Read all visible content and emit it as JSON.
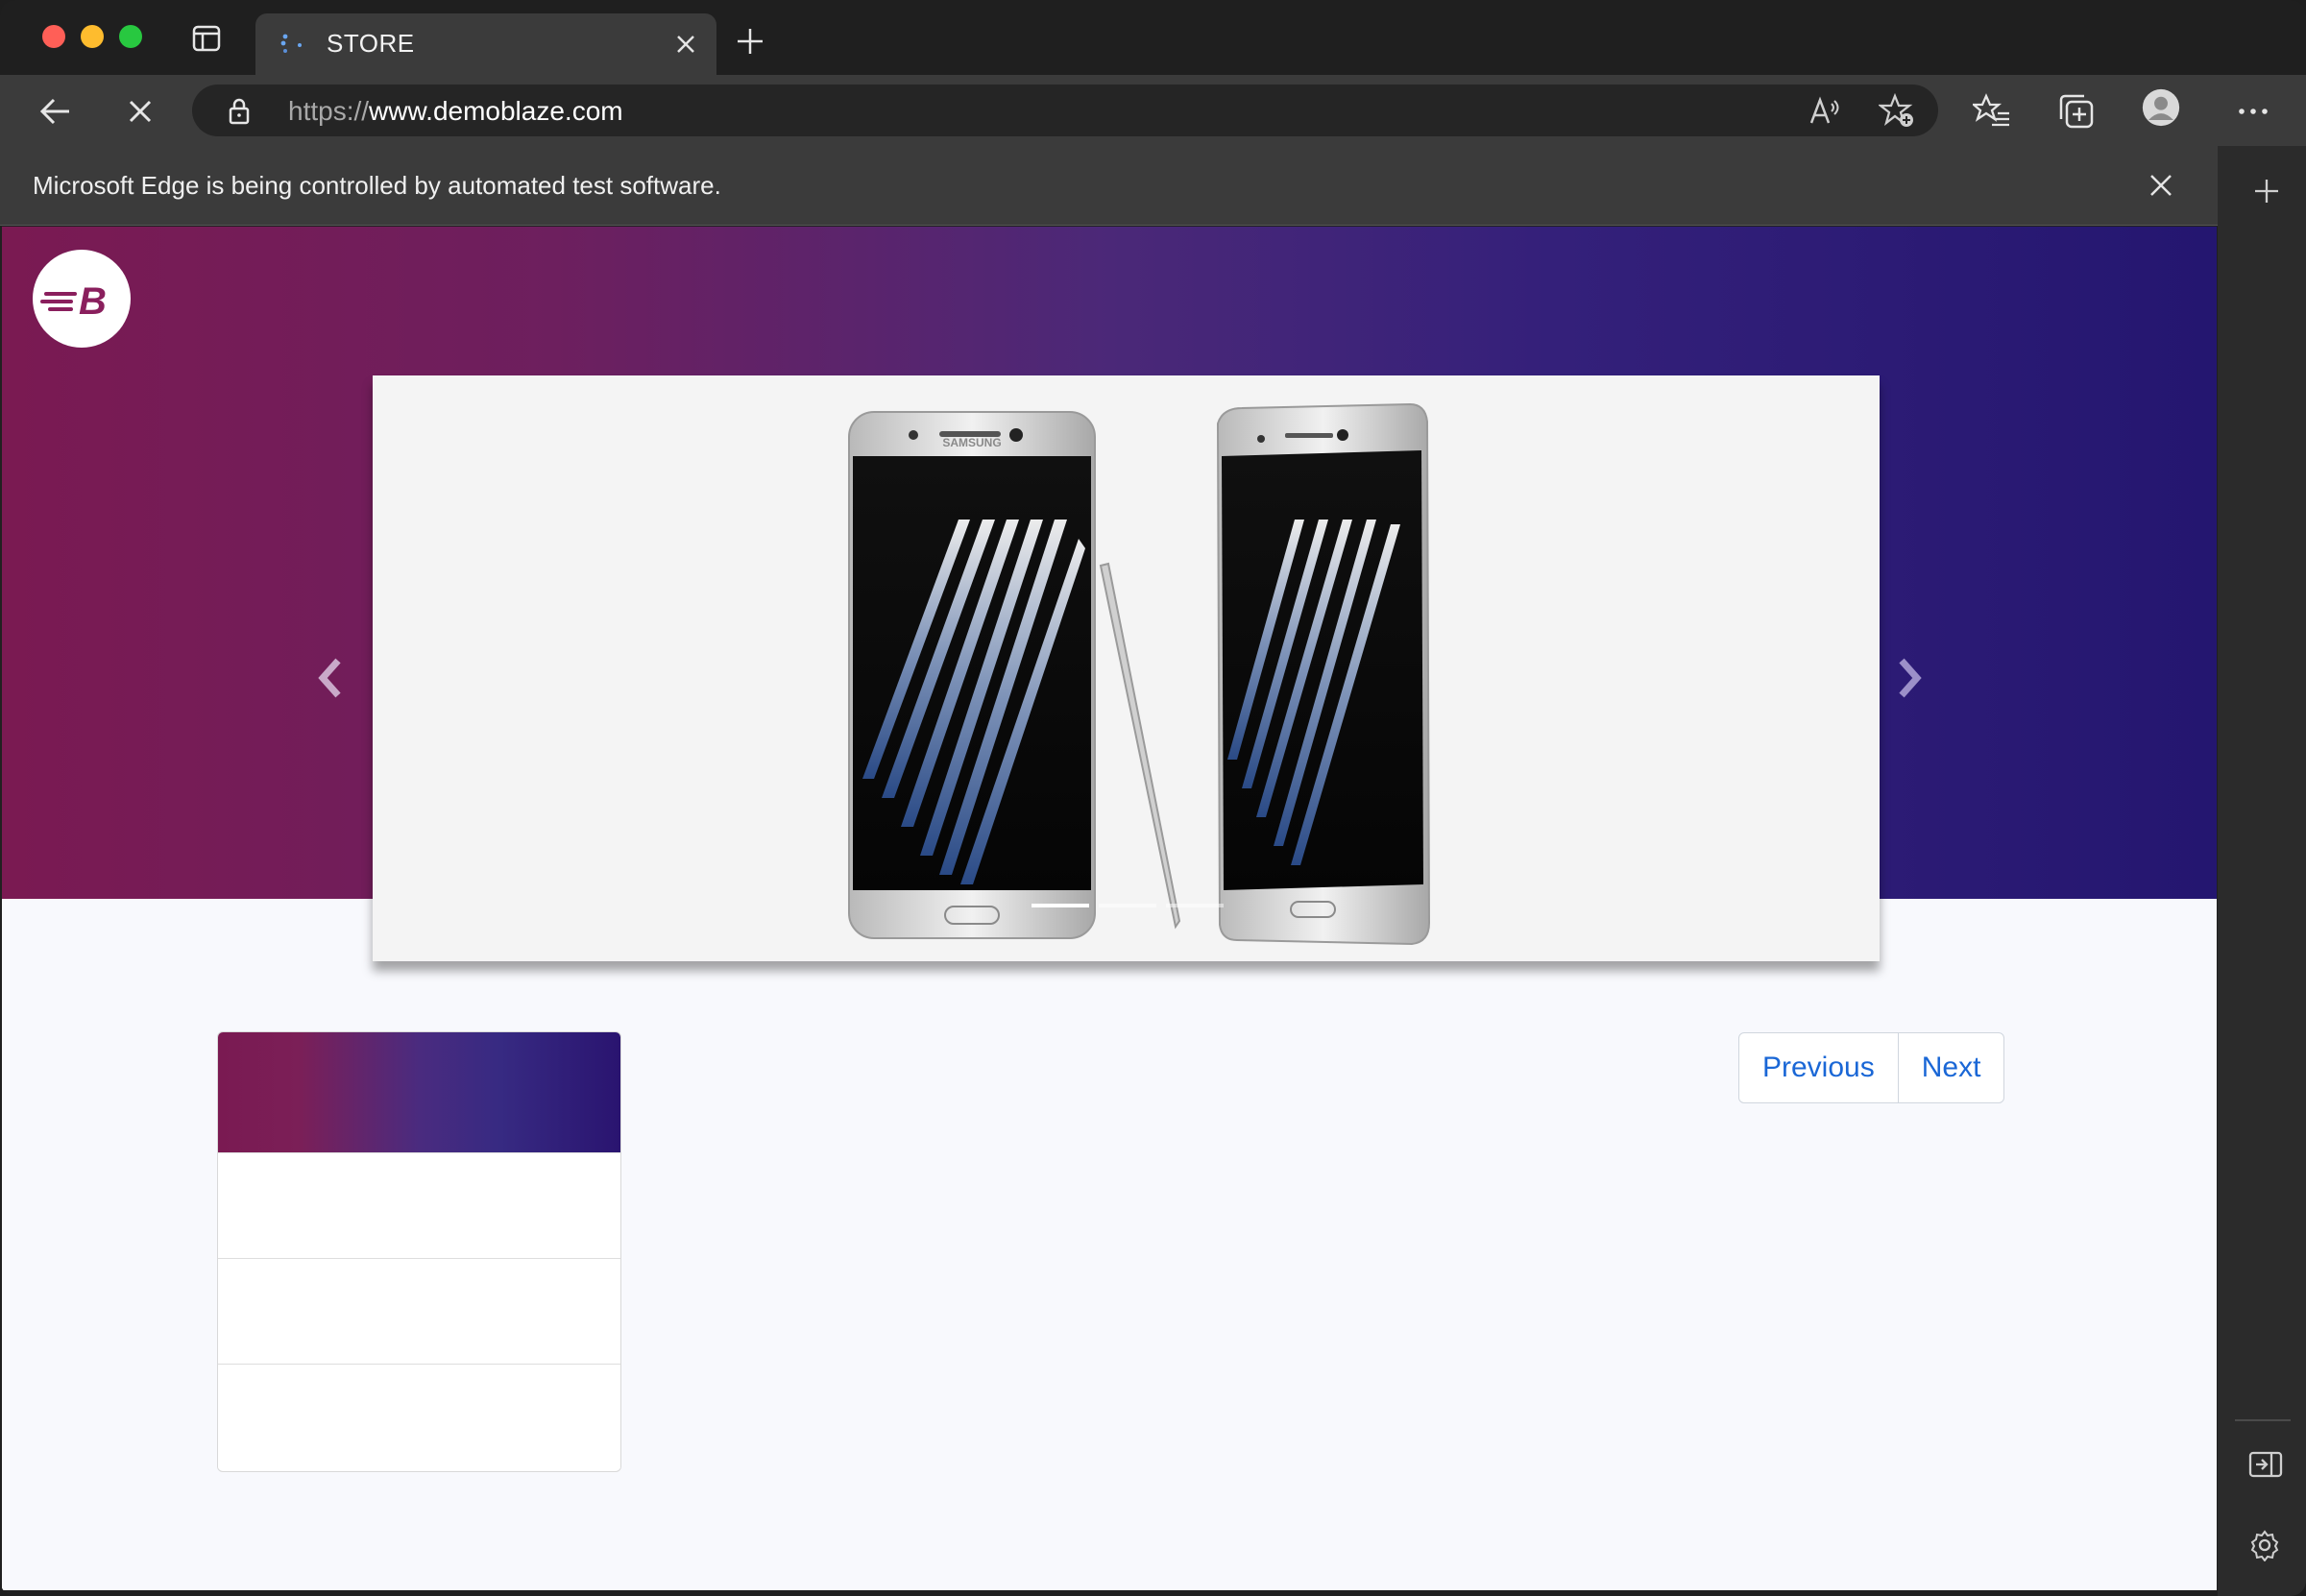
{
  "browser": {
    "tab_title": "STORE",
    "url_protocol": "https://",
    "url_host": "www.demoblaze.com",
    "infobar_text": "Microsoft Edge is being controlled by automated test software."
  },
  "store": {
    "logo_letter": "B",
    "carousel": {
      "image_label": "SAMSUNG",
      "active_slide": 1
    },
    "pagination": {
      "previous_label": "Previous",
      "next_label": "Next"
    }
  },
  "colors": {
    "hero_start": "#7a1a52",
    "hero_end": "#241670",
    "pager_link": "#1a67d6"
  },
  "icons": {
    "tab_actions": "tab-actions-icon",
    "loading": "loading-spinner-icon",
    "close": "close-icon",
    "new_tab": "plus-icon",
    "back": "back-arrow-icon",
    "stop": "stop-icon",
    "lock": "lock-icon",
    "read_aloud": "read-aloud-icon",
    "add_favorite": "add-favorite-icon",
    "favorites": "favorites-icon",
    "collections": "collections-icon",
    "profile": "profile-avatar-icon",
    "more": "more-icon",
    "sidebar_add": "plus-icon",
    "sidebar_hide": "sidebar-collapse-icon",
    "settings": "gear-icon"
  }
}
